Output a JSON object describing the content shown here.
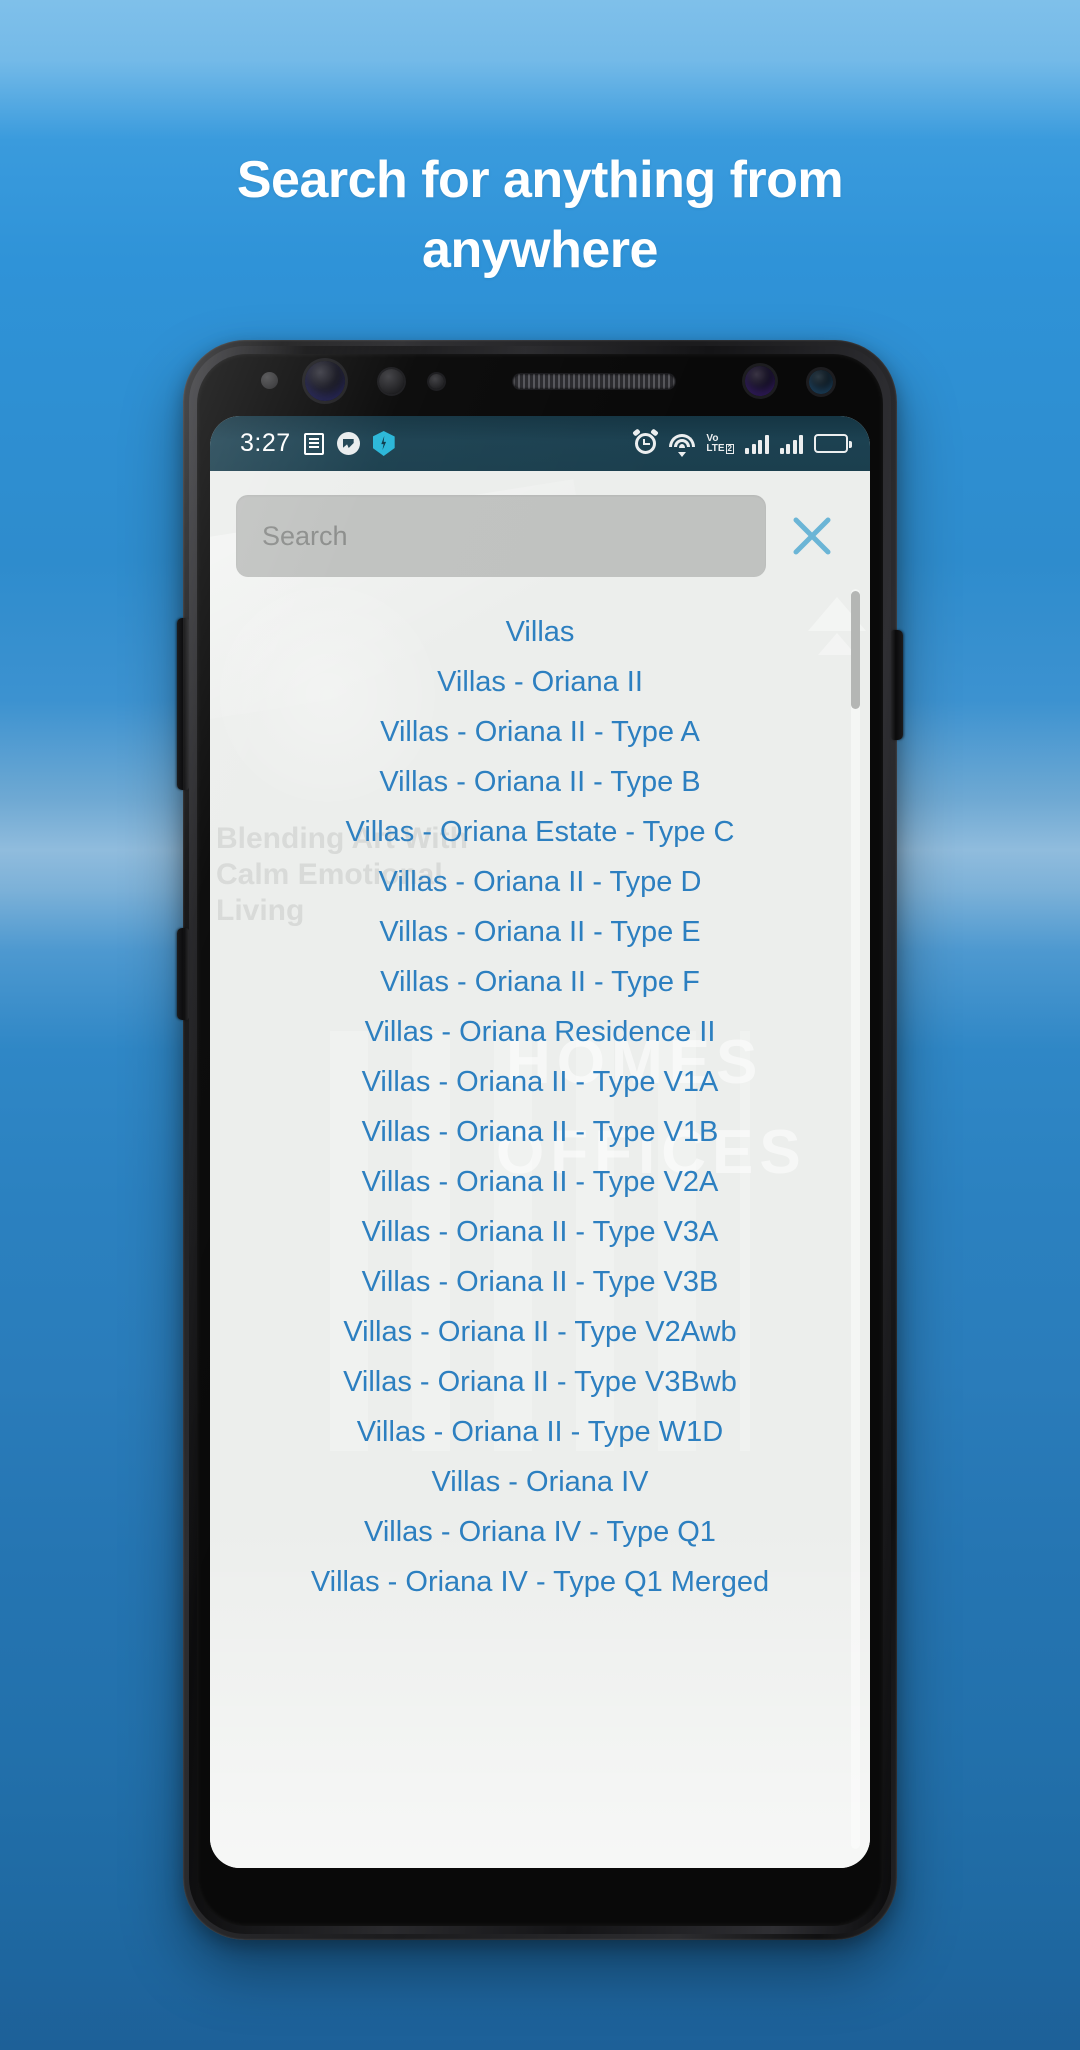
{
  "headline": {
    "line1": "Search for anything from",
    "line2": "anywhere"
  },
  "colors": {
    "background_top": "#7fc0ea",
    "background_bottom": "#1d6098",
    "headline_text": "#ffffff",
    "list_item_text": "#2c7fc0",
    "close_icon": "#6bb5d6",
    "search_field_bg": "#c0c2c0",
    "statusbar_bg": "#1b3f4e"
  },
  "statusbar": {
    "time": "3:27",
    "left_icons": [
      "news-icon",
      "messenger-icon",
      "shield-icon"
    ],
    "right_icons": [
      "alarm-icon",
      "wifi-icon",
      "volte-icon",
      "signal-bars-sim1-icon",
      "signal-bars-sim2-icon",
      "battery-icon"
    ],
    "volte": {
      "line1": "Vo",
      "line2": "LTE",
      "sim": "2"
    },
    "battery_level_percent": 62
  },
  "search": {
    "placeholder": "Search",
    "value": "",
    "close_label": "×"
  },
  "watermark": {
    "homes": "HOMES",
    "offices": "OFFICES",
    "words": "Blending Art With Calm Emotional Living"
  },
  "list": {
    "items": [
      "Villas",
      "Villas - Oriana II",
      "Villas - Oriana II - Type A",
      "Villas - Oriana II - Type B",
      "Villas - Oriana Estate - Type C",
      "Villas - Oriana II - Type D",
      "Villas - Oriana II - Type E",
      "Villas - Oriana II - Type F",
      "Villas - Oriana Residence II",
      "Villas - Oriana II - Type V1A",
      "Villas - Oriana II - Type V1B",
      "Villas - Oriana II - Type V2A",
      "Villas - Oriana II - Type V3A",
      "Villas - Oriana II - Type V3B",
      "Villas - Oriana II - Type V2Awb",
      "Villas - Oriana II - Type V3Bwb",
      "Villas - Oriana II - Type W1D",
      "Villas - Oriana IV",
      "Villas - Oriana IV - Type Q1",
      "Villas - Oriana IV - Type Q1 Merged"
    ]
  }
}
